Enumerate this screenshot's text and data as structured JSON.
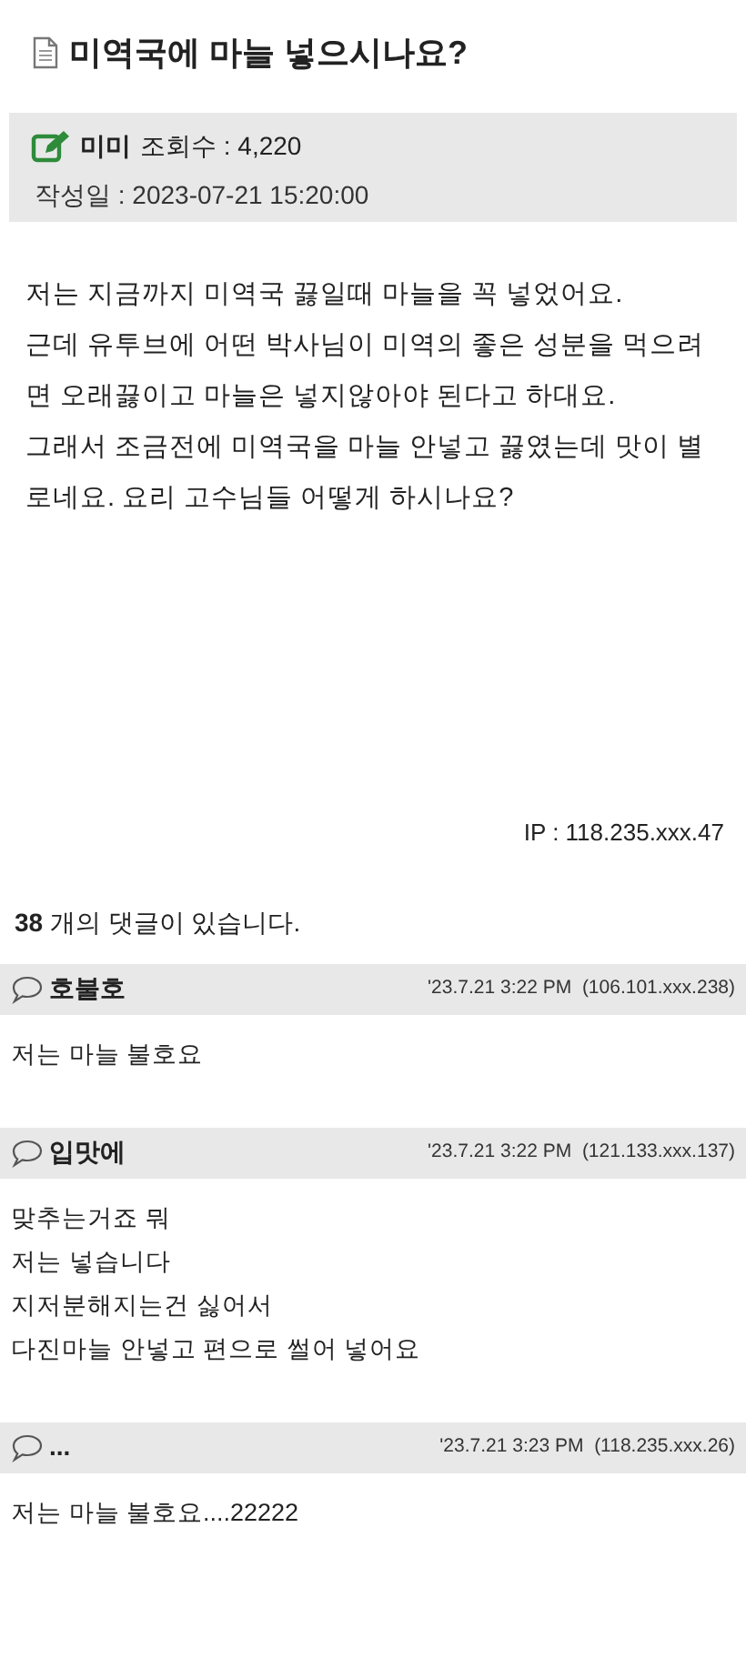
{
  "post": {
    "title": "미역국에 마늘 넣으시나요?",
    "author": "미미",
    "views": "조회수 : 4,220",
    "date": "작성일 : 2023-07-21 15:20:00",
    "body": [
      "저는 지금까지 미역국 끓일때 마늘을 꼭 넣었어요.",
      "근데 유투브에 어떤 박사님이 미역의 좋은 성분을 먹으려면 오래끓이고 마늘은 넣지않아야 된다고 하대요.",
      "그래서 조금전에 미역국을 마늘 안넣고 끓였는데 맛이 별로네요.  요리 고수님들 어떻게 하시나요?"
    ],
    "ip": "IP : 118.235.xxx.47"
  },
  "comment_count": "**38** 개의 댓글이 있습니다.",
  "comments": [
    {
      "author": "호불호",
      "meta": "'23.7.21 3:22 PM  (106.101.xxx.238)",
      "lines": [
        "저는 마늘 불호요"
      ]
    },
    {
      "author": "입맛에",
      "meta": "'23.7.21 3:22 PM  (121.133.xxx.137)",
      "lines": [
        "맞추는거죠 뭐",
        "저는 넣습니다",
        "지저분해지는건 싫어서",
        "다진마늘 안넣고 편으로 썰어 넣어요"
      ]
    },
    {
      "author": "...",
      "meta": "'23.7.21 3:23 PM  (118.235.xxx.26)",
      "lines": [
        "저는 마늘 불호요....22222"
      ]
    }
  ]
}
